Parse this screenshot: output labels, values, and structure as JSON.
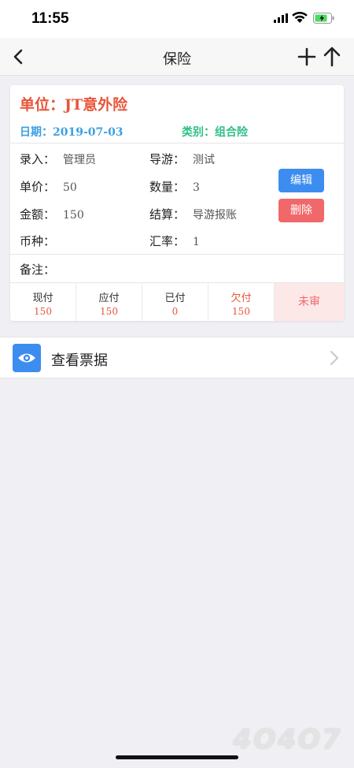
{
  "status_bar": {
    "time": "11:55"
  },
  "nav": {
    "title": "保险"
  },
  "card": {
    "unit": "单位：JT意外险",
    "date": "日期：2019-07-03",
    "category": "类别：组合险",
    "fields": {
      "entry": {
        "label": "录入：",
        "value": "管理员"
      },
      "guide": {
        "label": "导游：",
        "value": "测试"
      },
      "unit_price": {
        "label": "单价：",
        "value": "50"
      },
      "quantity": {
        "label": "数量：",
        "value": "3"
      },
      "amount": {
        "label": "金额：",
        "value": "150"
      },
      "settlement": {
        "label": "结算：",
        "value": "导游报账"
      },
      "currency": {
        "label": "币种：",
        "value": ""
      },
      "exchange_rate": {
        "label": "汇率：",
        "value": "1"
      },
      "remark": {
        "label": "备注：",
        "value": ""
      }
    },
    "buttons": {
      "edit": "编辑",
      "delete": "删除"
    },
    "stats": [
      {
        "label": "现付",
        "value": "150"
      },
      {
        "label": "应付",
        "value": "150"
      },
      {
        "label": "已付",
        "value": "0"
      },
      {
        "label": "欠付",
        "value": "150"
      }
    ],
    "audit_status": "未审"
  },
  "receipt": {
    "label": "查看票据"
  },
  "watermark": "4O4O7",
  "colors": {
    "accent_red": "#e8563a",
    "accent_blue": "#3d8df0",
    "accent_green": "#2fbf88",
    "date_blue": "#3ba0e0"
  }
}
